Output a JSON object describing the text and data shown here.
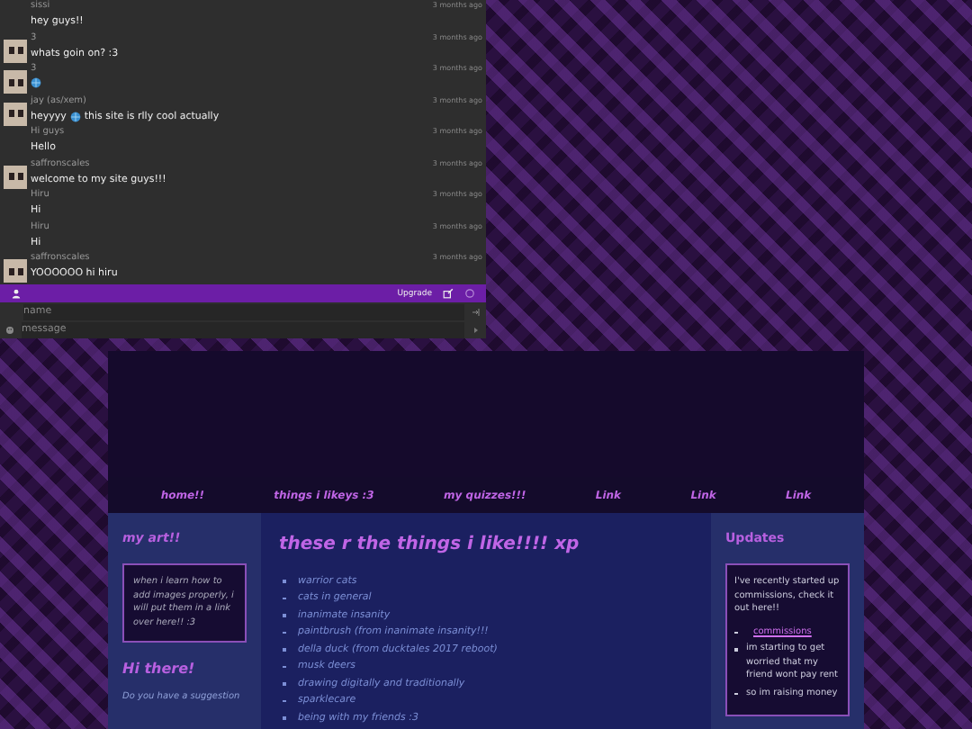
{
  "chat": {
    "messages": [
      {
        "avatar": false,
        "name": "sissi",
        "time": "3 months ago",
        "parts": [
          {
            "kind": "text",
            "text": "hey guys!!"
          }
        ]
      },
      {
        "avatar": true,
        "name": "3",
        "time": "3 months ago",
        "parts": [
          {
            "kind": "text",
            "text": "whats goin on? :3"
          }
        ]
      },
      {
        "avatar": true,
        "name": "3",
        "time": "3 months ago",
        "parts": [
          {
            "kind": "emoji"
          }
        ]
      },
      {
        "avatar": true,
        "name": "jay (as/xem)",
        "time": "3 months ago",
        "parts": [
          {
            "kind": "text",
            "text": "heyyyy"
          },
          {
            "kind": "emoji"
          },
          {
            "kind": "text",
            "text": "this site is rlly cool actually"
          }
        ]
      },
      {
        "avatar": false,
        "name": "Hi guys",
        "time": "3 months ago",
        "parts": [
          {
            "kind": "text",
            "text": "Hello"
          }
        ]
      },
      {
        "avatar": true,
        "name": "saffronscales",
        "time": "3 months ago",
        "parts": [
          {
            "kind": "text",
            "text": "welcome to my site guys!!!"
          }
        ]
      },
      {
        "avatar": false,
        "name": "Hiru",
        "time": "3 months ago",
        "parts": [
          {
            "kind": "text",
            "text": "Hi"
          }
        ]
      },
      {
        "avatar": false,
        "name": "Hiru",
        "time": "3 months ago",
        "parts": [
          {
            "kind": "text",
            "text": "Hi"
          }
        ]
      },
      {
        "avatar": true,
        "name": "saffronscales",
        "time": "3 months ago",
        "parts": [
          {
            "kind": "text",
            "text": "YOOOOOO hi hiru"
          }
        ]
      }
    ],
    "upgrade": "Upgrade",
    "name_placeholder": "name",
    "message_placeholder": "message"
  },
  "nav": [
    "home!!",
    "things i likeys :3",
    "my quizzes!!!",
    "Link",
    "Link",
    "Link"
  ],
  "left": {
    "title": "my art!!",
    "box_text": "when i learn how to add images properly, i will put them in a link over here!! :3",
    "title2": "Hi there!",
    "text2": "Do you have a suggestion"
  },
  "center": {
    "title": "these r the things i like!!!! xp",
    "items": [
      "warrior cats",
      "cats in general",
      "inanimate insanity",
      "paintbrush (from inanimate insanity!!!",
      "della duck (from ducktales 2017 reboot)",
      "musk deers",
      "drawing digitally and traditionally",
      "sparklecare",
      "being with my friends :3"
    ]
  },
  "right": {
    "title": "Updates",
    "intro": "I've recently started up commissions, check it out here!!",
    "link": "commissions",
    "items": [
      "im starting to get worried that my friend wont pay rent",
      "so im raising money"
    ]
  }
}
